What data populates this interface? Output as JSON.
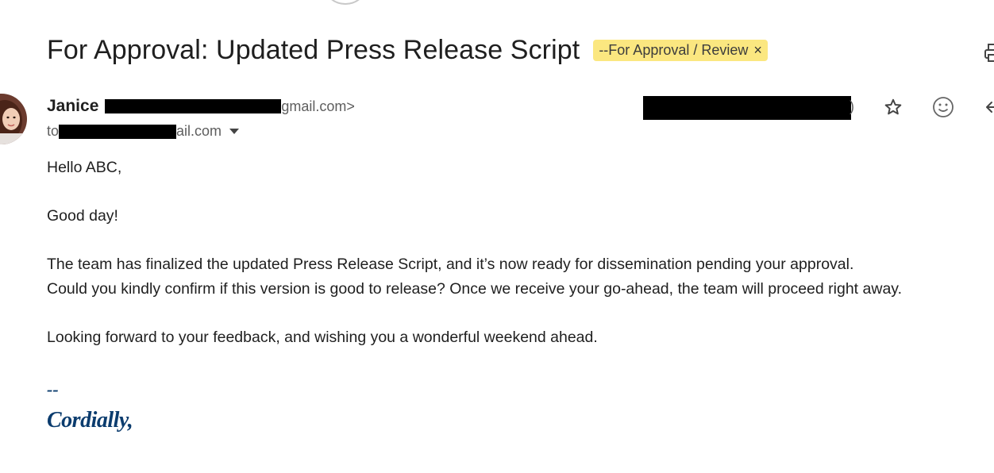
{
  "email": {
    "subject": "For Approval: Updated Press Release Script",
    "label": "--For Approval / Review",
    "label_remove": "×",
    "sender_name": "Janice",
    "sender_email_tail": "gmail.com>",
    "recipient_prefix": "to",
    "recipient_tail": "ail.com",
    "date_suffix": ")",
    "body": {
      "greeting": "Hello ABC,",
      "line1": "Good day!",
      "para1_line1": "The team has finalized the updated Press Release Script, and it’s now ready for dissemination pending your approval.",
      "para1_line2": "Could you kindly confirm if this version is good to release? Once we receive your go-ahead, the team will proceed right away.",
      "closing_line": "Looking forward to your feedback, and wishing you a wonderful weekend ahead."
    },
    "signature": {
      "dashes": "--",
      "closing": "Cordially,"
    }
  },
  "colors": {
    "label_bg": "#fbe780",
    "signature": "#0b3c6e"
  },
  "icons": [
    "print-icon",
    "star-icon",
    "emoji-icon",
    "reply-icon",
    "dropdown-caret-icon"
  ]
}
